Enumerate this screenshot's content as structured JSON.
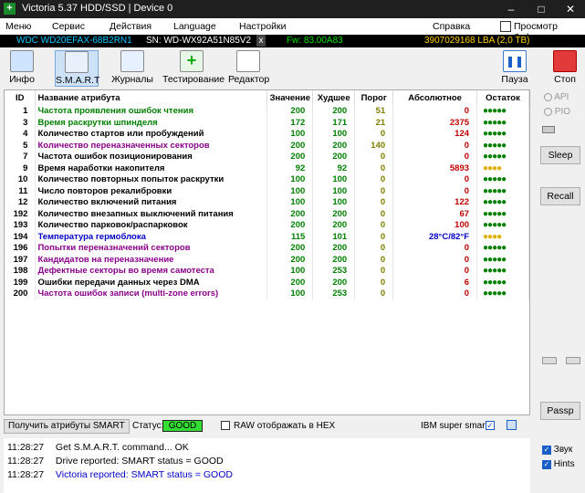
{
  "window": {
    "title": "Victoria 5.37 HDD/SSD | Device 0",
    "minimize": "–",
    "maximize": "□",
    "close": "✕"
  },
  "menu": {
    "items": [
      "Меню",
      "Сервис",
      "Действия",
      "Language",
      "Настройки",
      "Справка",
      "Просмотр буфера"
    ]
  },
  "device": {
    "model": "WDC WD20EFAX-68B2RN1",
    "serial": "SN: WD-WX92A51N85V2",
    "x": "x",
    "firmware": "Fw: 83.00A83",
    "lba": "3907029168 LBA (2,0 TB)"
  },
  "toolbar": {
    "info": "Инфо",
    "smart": "S.M.A.R.T",
    "logs": "Журналы",
    "testing": "Тестирование",
    "editor": "Редактор",
    "pause": "Пауза",
    "stop": "Стоп"
  },
  "table": {
    "headers": [
      "ID",
      "Название атрибута",
      "Значение",
      "Худшее",
      "Порог",
      "Абсолютное",
      "Остаток"
    ],
    "rows": [
      {
        "id": "1",
        "name": "Частота проявления ошибок чтения",
        "value": "200",
        "worst": "200",
        "threshold": "51",
        "raw": "0",
        "remain": "●●●●●",
        "nameColor": "green"
      },
      {
        "id": "3",
        "name": "Время раскрутки шпинделя",
        "value": "172",
        "worst": "171",
        "threshold": "21",
        "raw": "2375",
        "remain": "●●●●●",
        "nameColor": "green"
      },
      {
        "id": "4",
        "name": "Количество стартов или пробуждений",
        "value": "100",
        "worst": "100",
        "threshold": "0",
        "raw": "124",
        "remain": "●●●●●",
        "nameColor": "black"
      },
      {
        "id": "5",
        "name": "Количество переназначенных секторов",
        "value": "200",
        "worst": "200",
        "threshold": "140",
        "raw": "0",
        "remain": "●●●●●",
        "nameColor": "purple"
      },
      {
        "id": "7",
        "name": "Частота ошибок позиционирования",
        "value": "200",
        "worst": "200",
        "threshold": "0",
        "raw": "0",
        "remain": "●●●●●",
        "nameColor": "black"
      },
      {
        "id": "9",
        "name": "Время наработки накопителя",
        "value": "92",
        "worst": "92",
        "threshold": "0",
        "raw": "5893",
        "remain": "●●●●",
        "nameColor": "black"
      },
      {
        "id": "10",
        "name": "Количество повторных попыток раскрутки",
        "value": "100",
        "worst": "100",
        "threshold": "0",
        "raw": "0",
        "remain": "●●●●●",
        "nameColor": "black"
      },
      {
        "id": "11",
        "name": "Число повторов рекалибровки",
        "value": "100",
        "worst": "100",
        "threshold": "0",
        "raw": "0",
        "remain": "●●●●●",
        "nameColor": "black"
      },
      {
        "id": "12",
        "name": "Количество включений питания",
        "value": "100",
        "worst": "100",
        "threshold": "0",
        "raw": "122",
        "remain": "●●●●●",
        "nameColor": "black"
      },
      {
        "id": "192",
        "name": "Количество внезапных выключений питания",
        "value": "200",
        "worst": "200",
        "threshold": "0",
        "raw": "67",
        "remain": "●●●●●",
        "nameColor": "black"
      },
      {
        "id": "193",
        "name": "Количество парковок/распарковок",
        "value": "200",
        "worst": "200",
        "threshold": "0",
        "raw": "100",
        "remain": "●●●●●",
        "nameColor": "black"
      },
      {
        "id": "194",
        "name": "Температура гермоблока",
        "value": "115",
        "worst": "101",
        "threshold": "0",
        "raw": "28°C/82°F",
        "remain": "●●●●",
        "nameColor": "blue"
      },
      {
        "id": "196",
        "name": "Попытки переназначений секторов",
        "value": "200",
        "worst": "200",
        "threshold": "0",
        "raw": "0",
        "remain": "●●●●●",
        "nameColor": "purple"
      },
      {
        "id": "197",
        "name": "Кандидатов на переназначение",
        "value": "200",
        "worst": "200",
        "threshold": "0",
        "raw": "0",
        "remain": "●●●●●",
        "nameColor": "purple"
      },
      {
        "id": "198",
        "name": "Дефектные секторы во время самотеста",
        "value": "100",
        "worst": "253",
        "threshold": "0",
        "raw": "0",
        "remain": "●●●●●",
        "nameColor": "purple"
      },
      {
        "id": "199",
        "name": "Ошибки передачи данных через DMA",
        "value": "200",
        "worst": "200",
        "threshold": "0",
        "raw": "6",
        "remain": "●●●●●",
        "nameColor": "black"
      },
      {
        "id": "200",
        "name": "Частота ошибок записи (multi-zone errors)",
        "value": "100",
        "worst": "253",
        "threshold": "0",
        "raw": "0",
        "remain": "●●●●●",
        "nameColor": "purple"
      }
    ]
  },
  "rightpanel": {
    "api": "API",
    "pio": "PIO",
    "sleep": "Sleep",
    "recall": "Recall",
    "passp": "Passp"
  },
  "status": {
    "get_button": "Получить атрибуты SMART",
    "status_label": "Статус:",
    "status_value": "GOOD",
    "raw_hex": "RAW отображать в HEX",
    "ibm_label": "IBM super smart:"
  },
  "log": [
    {
      "time": "11:28:27",
      "text": "Get S.M.A.R.T. command... OK",
      "color": "#000000"
    },
    {
      "time": "11:28:27",
      "text": "Drive reported: SMART status = GOOD",
      "color": "#000000"
    },
    {
      "time": "11:28:27",
      "text": "Victoria reported: SMART status = GOOD",
      "color": "#0000c8"
    }
  ],
  "side_checks": {
    "sound": "Звук",
    "hints": "Hints"
  },
  "colors": {
    "green": "#008000",
    "purple": "#8a008a",
    "blue": "#0000c8",
    "red": "#c00000",
    "olive": "#808000",
    "good_bg": "#33dd33",
    "remain_green": "#008000",
    "remain_yellow": "#e0b000"
  }
}
